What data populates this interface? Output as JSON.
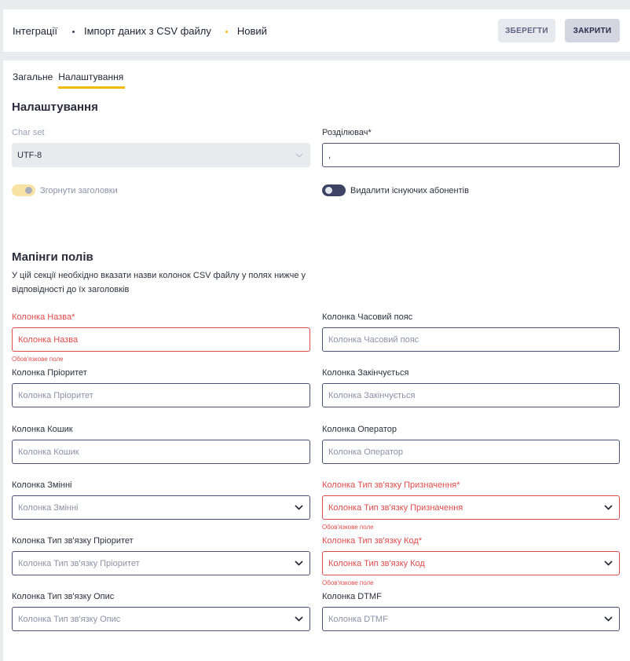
{
  "header": {
    "breadcrumbs": [
      "Інтеграції",
      "Імпорт даних з CSV файлу",
      "Новий"
    ],
    "save_label": "ЗБЕРЕГТИ",
    "close_label": "ЗАКРИТИ"
  },
  "tabs": [
    {
      "label": "Загальне",
      "active": false
    },
    {
      "label": "Налаштування",
      "active": true
    }
  ],
  "settings": {
    "title": "Налаштування",
    "charset": {
      "label": "Char set",
      "value": "UTF-8",
      "disabled": true
    },
    "separator": {
      "label": "Розділювач*",
      "value": ","
    },
    "collapse_headers": {
      "label": "Згорнути заголовки",
      "checked": true,
      "disabled": true
    },
    "delete_existing": {
      "label": "Видалити існуючих абонентів",
      "checked": false
    }
  },
  "mapping": {
    "title": "Мапінги полів",
    "description": "У цій секції необхідно вказати назви колонок CSV файлу у полях нижче у відповідності до їх заголовків",
    "required_hint": "Обов'язкове поле",
    "fields": {
      "name": {
        "label": "Колонка Назва*",
        "placeholder": "Колонка Назва"
      },
      "timezone": {
        "label": "Колонка Часовий пояс",
        "placeholder": "Колонка Часовий пояс"
      },
      "priority": {
        "label": "Колонка Пріоритет",
        "placeholder": "Колонка Пріоритет"
      },
      "ends": {
        "label": "Колонка Закінчується",
        "placeholder": "Колонка Закінчується"
      },
      "bucket": {
        "label": "Колонка Кошик",
        "placeholder": "Колонка Кошик"
      },
      "operator": {
        "label": "Колонка Оператор",
        "placeholder": "Колонка Оператор"
      },
      "variables": {
        "label": "Колонка Змінні",
        "placeholder": "Колонка Змінні"
      },
      "comm_type_dest": {
        "label": "Колонка Тип зв'язку Призначення*",
        "placeholder": "Колонка Тип зв'язку Призначення"
      },
      "comm_type_priority": {
        "label": "Колонка Тип зв'язку Пріоритет",
        "placeholder": "Колонка Тип зв'язку Пріоритет"
      },
      "comm_type_code": {
        "label": "Колонка Тип зв'язку Код*",
        "placeholder": "Колонка Тип зв'язку Код"
      },
      "comm_type_desc": {
        "label": "Колонка Тип зв'язку Опис",
        "placeholder": "Колонка Тип зв'язку Опис"
      },
      "dtmf": {
        "label": "Колонка DTMF",
        "placeholder": "Колонка DTMF"
      }
    }
  },
  "colors": {
    "accent": "#f5b90a",
    "error": "#e04b4b",
    "border": "#4a5176"
  },
  "icons": [
    "chevron-down-icon"
  ]
}
